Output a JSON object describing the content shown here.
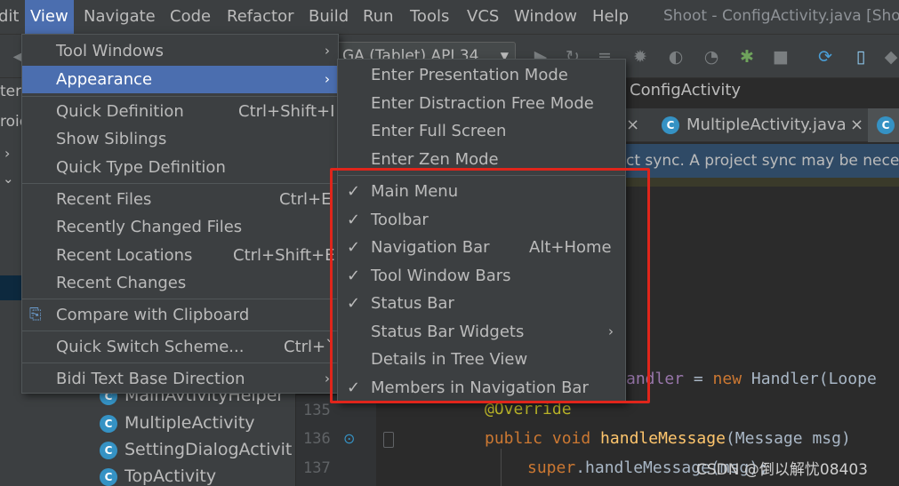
{
  "menubar": {
    "items": [
      "dit",
      "View",
      "Navigate",
      "Code",
      "Refactor",
      "Build",
      "Run",
      "Tools",
      "VCS",
      "Window",
      "Help"
    ],
    "window_title": "Shoot - ConfigActivity.java [Sho"
  },
  "toolbar": {
    "device_selector": "GA (Tablet) API 34"
  },
  "project_panel": {
    "header_fragment": "ter",
    "row_fragment": "roid",
    "tree_items": [
      "MainAvtivityHelper",
      "MultipleActivity",
      "SettingDialogActivit",
      "TopActivity"
    ],
    "class_icon_letter": "C"
  },
  "editor": {
    "nav_title": "ConfigActivity",
    "tabs": [
      {
        "label": "MultipleActivity.java"
      }
    ],
    "close_glyph": "×",
    "sync_banner": "ct sync. A project sync may be neces",
    "line_numbers": [
      "135",
      "136",
      "137"
    ],
    "code": {
      "line1_field": "andler",
      "line1_op": " = ",
      "line1_kw": "new",
      "line1_rest": " Handler(Loope",
      "line2": "@Override",
      "line3_kw": "public void",
      "line3_fn": " handleMessage",
      "line3_rest": "(Message msg)",
      "line4_kw": "super",
      "line4_rest": ".handleMessage(msg);"
    }
  },
  "view_menu": {
    "items": [
      {
        "label": "Tool Windows",
        "shortcut": "",
        "submenu": true
      },
      {
        "label": "Appearance",
        "shortcut": "",
        "submenu": true
      },
      {
        "label": "Quick Definition",
        "shortcut": "Ctrl+Shift+I"
      },
      {
        "label": "Show Siblings",
        "shortcut": ""
      },
      {
        "label": "Quick Type Definition",
        "shortcut": ""
      },
      {
        "label": "Recent Files",
        "shortcut": "Ctrl+E"
      },
      {
        "label": "Recently Changed Files",
        "shortcut": ""
      },
      {
        "label": "Recent Locations",
        "shortcut": "Ctrl+Shift+E"
      },
      {
        "label": "Recent Changes",
        "shortcut": ""
      },
      {
        "label": "Compare with Clipboard",
        "shortcut": ""
      },
      {
        "label": "Quick Switch Scheme...",
        "shortcut": "Ctrl+`"
      },
      {
        "label": "Bidi Text Base Direction",
        "shortcut": "",
        "submenu": true
      }
    ],
    "submenu_glyph": "›"
  },
  "appearance_menu": {
    "items": [
      {
        "label": "Enter Presentation Mode",
        "checked": false
      },
      {
        "label": "Enter Distraction Free Mode",
        "checked": false
      },
      {
        "label": "Enter Full Screen",
        "checked": false
      },
      {
        "label": "Enter Zen Mode",
        "checked": false
      },
      {
        "label": "Main Menu",
        "checked": true
      },
      {
        "label": "Toolbar",
        "checked": true
      },
      {
        "label": "Navigation Bar",
        "checked": true,
        "shortcut": "Alt+Home"
      },
      {
        "label": "Tool Window Bars",
        "checked": true
      },
      {
        "label": "Status Bar",
        "checked": true
      },
      {
        "label": "Status Bar Widgets",
        "checked": false,
        "submenu": true
      },
      {
        "label": "Details in Tree View",
        "checked": false
      },
      {
        "label": "Members in Navigation Bar",
        "checked": true
      }
    ],
    "check_glyph": "✓",
    "submenu_glyph": "›"
  },
  "watermark": "CSDN @倒以解忧08403",
  "colors": {
    "menu_bg": "#3c3f41",
    "selection": "#4b6eaf",
    "highlight_box": "#e0251b",
    "editor_bg": "#2b2b2b"
  }
}
